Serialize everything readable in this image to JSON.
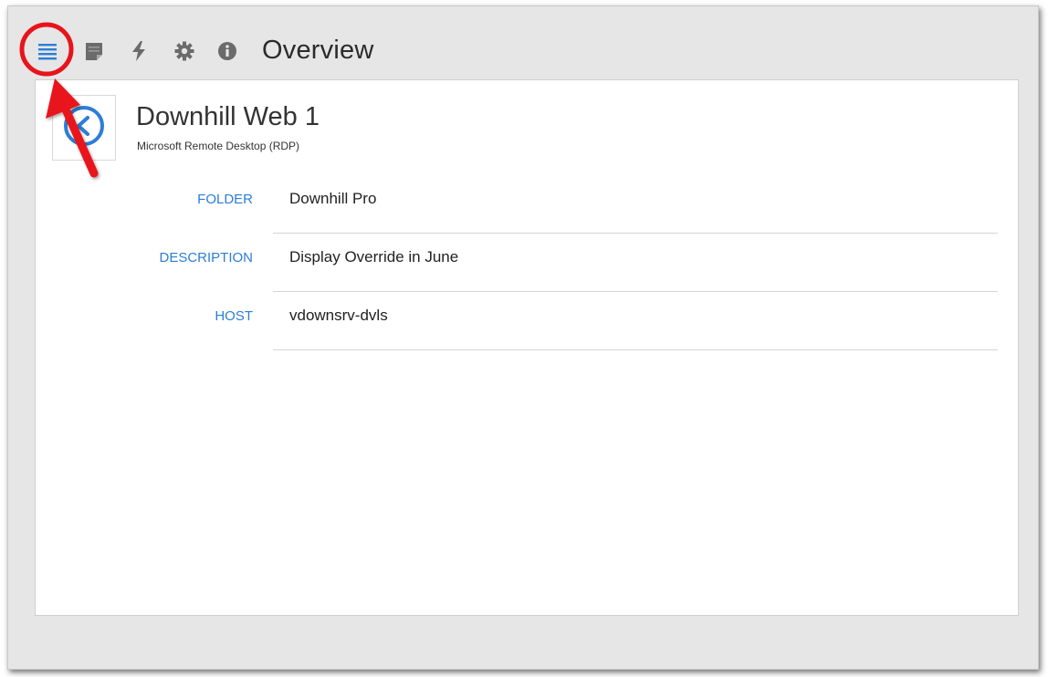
{
  "toolbar": {
    "title": "Overview",
    "icons": [
      "list-icon",
      "notes-icon",
      "macro-icon",
      "gear-icon",
      "info-icon"
    ],
    "active_color": "#2c7ed6",
    "icon_color": "#6b6b6b"
  },
  "entry": {
    "name": "Downhill Web 1",
    "type": "Microsoft Remote Desktop (RDP)",
    "icon": "remote-desktop-icon"
  },
  "fields": [
    {
      "label": "FOLDER",
      "value": "Downhill Pro"
    },
    {
      "label": "DESCRIPTION",
      "value": "Display Override in June"
    },
    {
      "label": "HOST",
      "value": "vdownsrv-dvls"
    }
  ],
  "annotation": {
    "color": "#e8141b",
    "kind": "highlight-circle-and-arrow"
  }
}
